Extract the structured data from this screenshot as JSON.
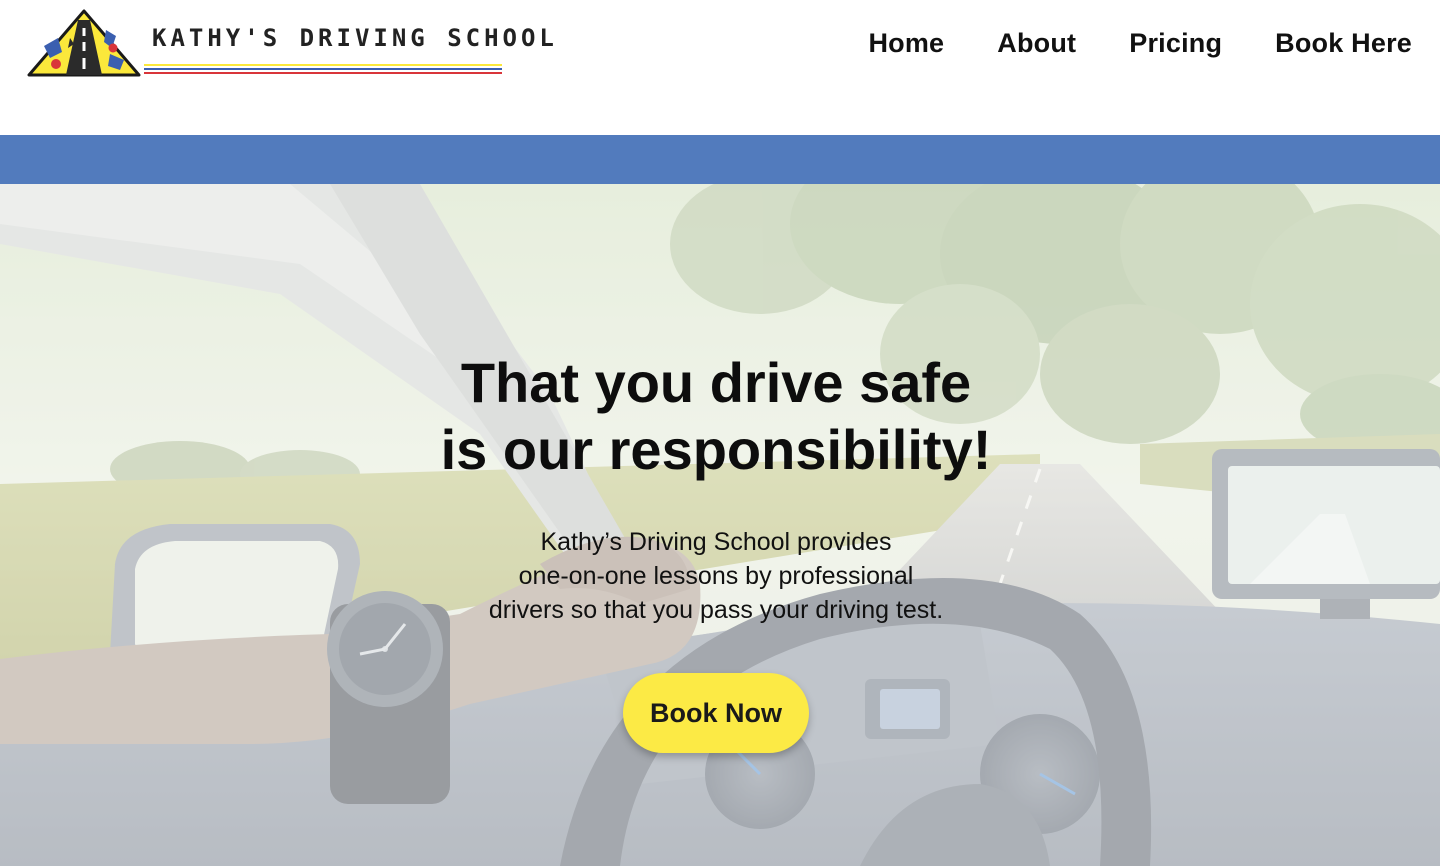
{
  "header": {
    "logo_text": "KATHY'S DRIVING SCHOOL",
    "nav": [
      {
        "label": "Home"
      },
      {
        "label": "About"
      },
      {
        "label": "Pricing"
      },
      {
        "label": "Book Here"
      }
    ]
  },
  "hero": {
    "title_lines": [
      "That you drive safe",
      "is our responsibility!"
    ],
    "body_lines": [
      "Kathy’s Driving School provides",
      "one-on-one lessons by professional",
      "drivers so that you pass your driving test."
    ],
    "cta_label": "Book Now",
    "background_image": "car-interior-driving-on-tree-lined-road"
  },
  "colors": {
    "band_blue": "#527bbd",
    "cta_yellow": "#fcea45",
    "logo_yellow": "#fbe83b",
    "logo_blue": "#3b5fb0",
    "logo_red": "#d9353a"
  }
}
